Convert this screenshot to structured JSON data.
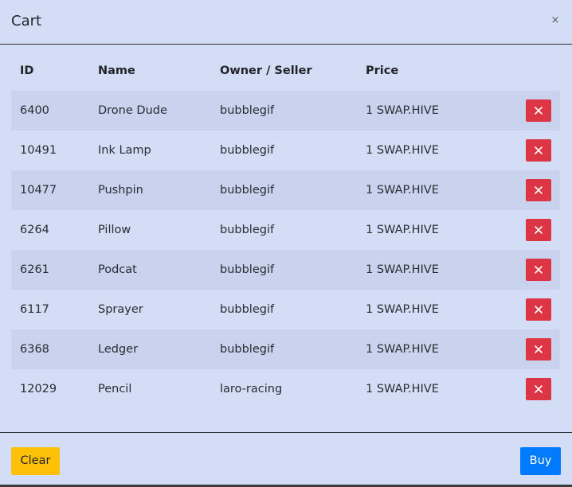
{
  "modal": {
    "title": "Cart",
    "close_label": "×"
  },
  "table": {
    "headers": {
      "id": "ID",
      "name": "Name",
      "owner": "Owner / Seller",
      "price": "Price"
    },
    "rows": [
      {
        "id": "6400",
        "name": "Drone Dude",
        "owner": "bubblegif",
        "price": "1 SWAP.HIVE"
      },
      {
        "id": "10491",
        "name": "Ink Lamp",
        "owner": "bubblegif",
        "price": "1 SWAP.HIVE"
      },
      {
        "id": "10477",
        "name": "Pushpin",
        "owner": "bubblegif",
        "price": "1 SWAP.HIVE"
      },
      {
        "id": "6264",
        "name": "Pillow",
        "owner": "bubblegif",
        "price": "1 SWAP.HIVE"
      },
      {
        "id": "6261",
        "name": "Podcat",
        "owner": "bubblegif",
        "price": "1 SWAP.HIVE"
      },
      {
        "id": "6117",
        "name": "Sprayer",
        "owner": "bubblegif",
        "price": "1 SWAP.HIVE"
      },
      {
        "id": "6368",
        "name": "Ledger",
        "owner": "bubblegif",
        "price": "1 SWAP.HIVE"
      },
      {
        "id": "12029",
        "name": "Pencil",
        "owner": "laro-racing",
        "price": "1 SWAP.HIVE"
      }
    ],
    "remove_icon": "close-icon"
  },
  "footer": {
    "clear_label": "Clear",
    "buy_label": "Buy"
  },
  "colors": {
    "background": "#d4ddf6",
    "row_stripe": "#c9d3ee",
    "danger": "#dc3545",
    "warning": "#ffc107",
    "primary": "#007bff"
  }
}
